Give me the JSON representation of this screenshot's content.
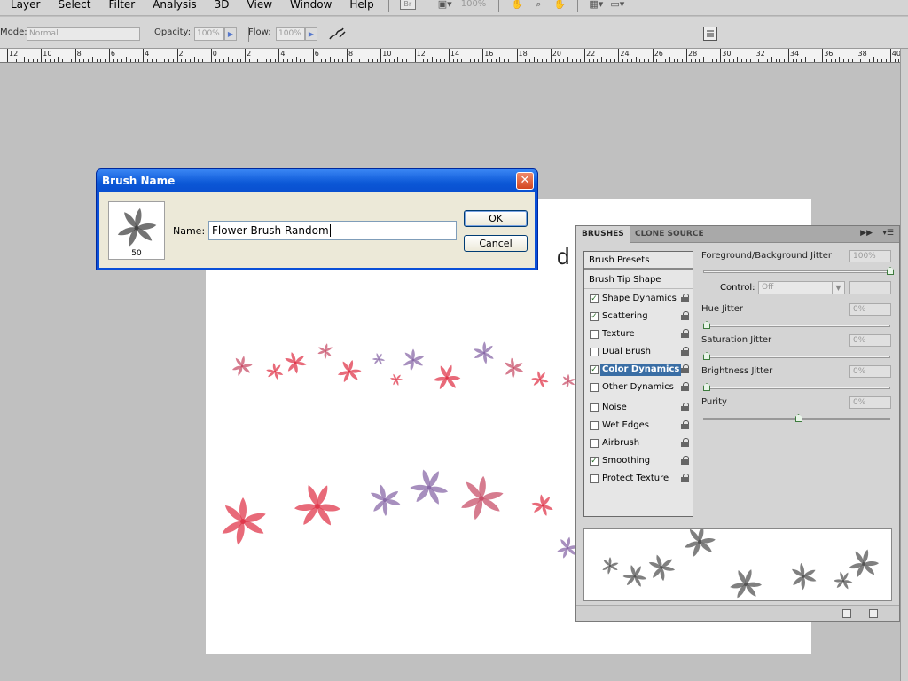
{
  "menu": [
    "Layer",
    "Select",
    "Filter",
    "Analysis",
    "3D",
    "View",
    "Window",
    "Help"
  ],
  "toolbar": {
    "bridge_label": "Br",
    "zoom": "100%"
  },
  "options": {
    "mode_label": "Mode:",
    "mode_value": "Normal",
    "opacity_label": "Opacity:",
    "opacity_value": "100%",
    "flow_label": "Flow:",
    "flow_value": "100%"
  },
  "ruler": {
    "labels": [
      "12",
      "10",
      "8",
      "6",
      "4",
      "2",
      "0",
      "2",
      "4",
      "6",
      "8",
      "10",
      "12",
      "14",
      "16",
      "18",
      "20",
      "22",
      "24",
      "26",
      "28",
      "30",
      "32",
      "34",
      "36",
      "38",
      "40"
    ]
  },
  "canvas": {
    "text": "d Ji"
  },
  "dialog": {
    "title": "Brush Name",
    "brush_size": "50",
    "name_label": "Name:",
    "name_value": "Flower Brush Random",
    "ok_label": "OK",
    "cancel_label": "Cancel"
  },
  "panel": {
    "tabs": [
      "BRUSHES",
      "CLONE SOURCE"
    ],
    "brush_presets": "Brush Presets",
    "brush_tip_shape": "Brush Tip Shape",
    "options": [
      {
        "label": "Shape Dynamics",
        "checked": true,
        "selected": false
      },
      {
        "label": "Scattering",
        "checked": true,
        "selected": false
      },
      {
        "label": "Texture",
        "checked": false,
        "selected": false
      },
      {
        "label": "Dual Brush",
        "checked": false,
        "selected": false
      },
      {
        "label": "Color Dynamics",
        "checked": true,
        "selected": true
      },
      {
        "label": "Other Dynamics",
        "checked": false,
        "selected": false
      },
      {
        "label": "Noise",
        "checked": false,
        "selected": false
      },
      {
        "label": "Wet Edges",
        "checked": false,
        "selected": false
      },
      {
        "label": "Airbrush",
        "checked": false,
        "selected": false
      },
      {
        "label": "Smoothing",
        "checked": true,
        "selected": false
      },
      {
        "label": "Protect Texture",
        "checked": false,
        "selected": false
      }
    ],
    "fg_bg_jitter_label": "Foreground/Background Jitter",
    "fg_bg_jitter_value": "100%",
    "fg_bg_jitter_level": 1.0,
    "control_label": "Control:",
    "control_value": "Off",
    "hue_jitter_label": "Hue Jitter",
    "hue_jitter_value": "0%",
    "hue_jitter_level": 0,
    "saturation_jitter_label": "Saturation Jitter",
    "saturation_jitter_value": "0%",
    "saturation_jitter_level": 0,
    "brightness_jitter_label": "Brightness Jitter",
    "brightness_jitter_value": "0%",
    "brightness_jitter_level": 0,
    "purity_label": "Purity",
    "purity_value": "0%",
    "purity_level": 0.5
  },
  "colors": {
    "flower_red": "#e0384c",
    "flower_purple": "#8a6aa8",
    "flower_pink": "#c8506a",
    "preview_gray": "#555555"
  }
}
